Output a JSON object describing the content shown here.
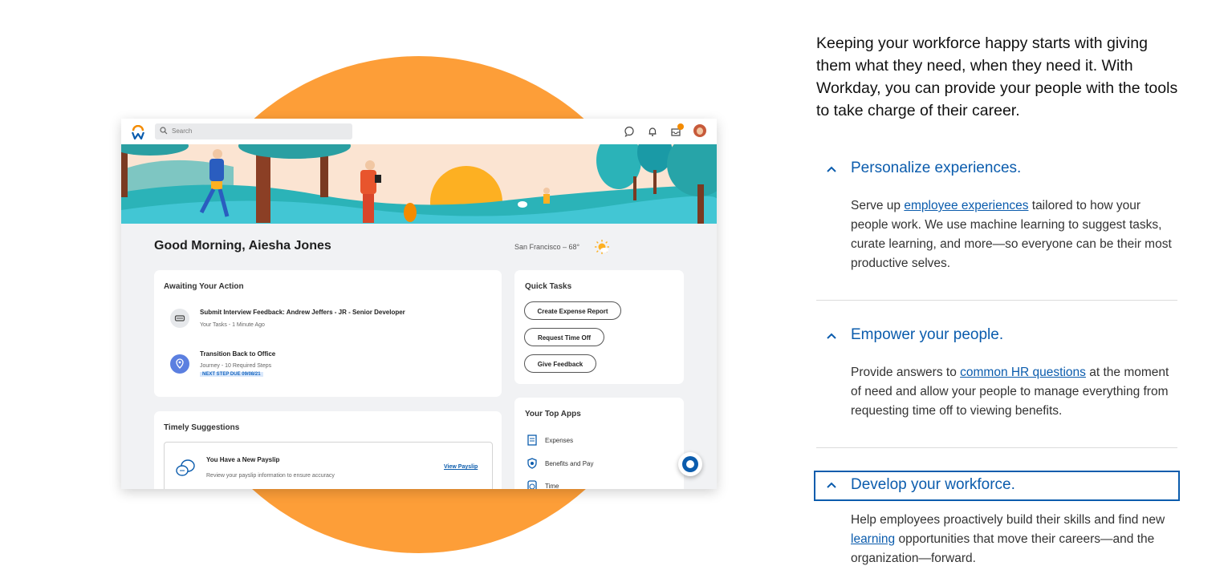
{
  "mockup": {
    "search_placeholder": "Search",
    "notification_count": "",
    "greeting": "Good Morning, Aiesha Jones",
    "weather": "San Francisco – 68°",
    "awaiting": {
      "title": "Awaiting Your Action",
      "items": [
        {
          "title": "Submit Interview Feedback: Andrew Jeffers - JR - Senior Developer",
          "sub": "Your Tasks - 1 Minute Ago"
        },
        {
          "title": "Transition Back to Office",
          "sub": "Journey - 10 Required Steps",
          "due": "NEXT STEP DUE 09/08/21"
        }
      ]
    },
    "quick_tasks": {
      "title": "Quick Tasks",
      "buttons": [
        "Create Expense Report",
        "Request Time Off",
        "Give Feedback"
      ]
    },
    "top_apps": {
      "title": "Your Top Apps",
      "items": [
        "Expenses",
        "Benefits and Pay",
        "Time"
      ]
    },
    "suggestions": {
      "title": "Timely Suggestions",
      "payslip_title": "You Have a New Payslip",
      "payslip_sub": "Review your payslip information to ensure accuracy",
      "payslip_link": "View Payslip"
    }
  },
  "intro": "Keeping your workforce happy starts with giving them what they need, when they need it. With Workday, you can provide your people with the tools to take charge of their career.",
  "accordion": [
    {
      "title": "Personalize experiences.",
      "before": "Serve up ",
      "link": "employee experiences",
      "after": " tailored to how your people work. We use machine learning to suggest tasks, curate learning, and more—so everyone can be their most productive selves."
    },
    {
      "title": "Empower your people.",
      "before": "Provide answers to ",
      "link": "common HR questions",
      "after": " at the moment of need and allow your people to manage everything from requesting time off to viewing benefits."
    },
    {
      "title": "Develop your workforce.",
      "before": "Help employees proactively build their skills and find new ",
      "link": "learning",
      "after": " opportunities that move their careers—and the organization—forward."
    }
  ],
  "colors": {
    "accent": "#0b5cad",
    "circle": "#fd9e38",
    "banner_teal": "#2bb3b8"
  },
  "icons": [
    "search-icon",
    "chat-icon",
    "bell-icon",
    "inbox-icon",
    "chevron-up-icon",
    "sun-icon",
    "location-pin-icon",
    "car-icon"
  ]
}
